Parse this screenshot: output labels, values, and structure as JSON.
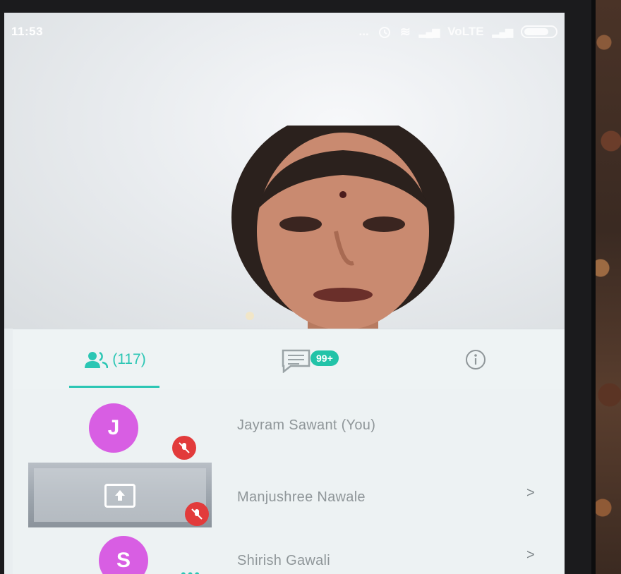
{
  "status_bar": {
    "time": "11:53",
    "indicators": "... ",
    "network": "VoLTE"
  },
  "tabs": {
    "participants_count": "(117)",
    "chat_badge": "99+"
  },
  "participants": [
    {
      "initial": "J",
      "name": "Jayram Sawant (You)",
      "avatar_color": "#d85ee3"
    },
    {
      "initial": "",
      "name": "Manjushree Nawale",
      "avatar_color": ""
    },
    {
      "initial": "S",
      "name": "Shirish Gawali",
      "avatar_color": "#d85ee3"
    }
  ],
  "chevron": ">",
  "colors": {
    "accent": "#2bc6b4",
    "mute": "#e23b3b",
    "avatar": "#d85ee3"
  }
}
